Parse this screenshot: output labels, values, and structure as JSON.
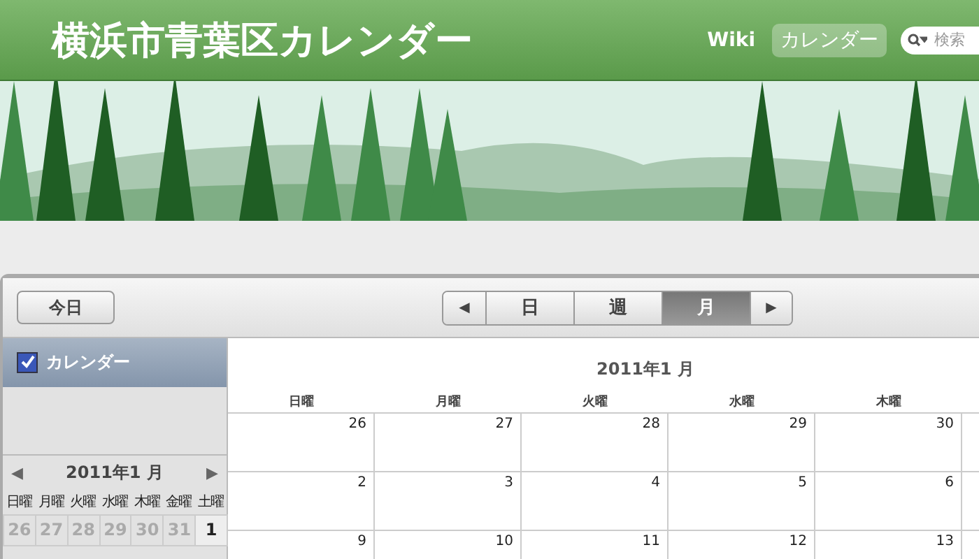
{
  "header": {
    "title": "横浜市青葉区カレンダー",
    "nav": [
      {
        "label": "Wiki",
        "selected": false
      },
      {
        "label": "カレンダー",
        "selected": true
      }
    ],
    "search": {
      "placeholder": "検索"
    }
  },
  "toolbar": {
    "today": "今日",
    "prev": "◀",
    "next": "▶",
    "views": [
      {
        "label": "日",
        "selected": false
      },
      {
        "label": "週",
        "selected": false
      },
      {
        "label": "月",
        "selected": true
      }
    ]
  },
  "sidebar": {
    "calendars": [
      {
        "label": "カレンダー",
        "checked": true
      }
    ],
    "mini_calendar": {
      "prev": "◀",
      "title": "2011年1 月",
      "next": "▶",
      "weekdays": [
        "日曜",
        "月曜",
        "火曜",
        "水曜",
        "木曜",
        "金曜",
        "土曜"
      ],
      "weeks": [
        [
          {
            "day": "26",
            "other_month": true
          },
          {
            "day": "27",
            "other_month": true
          },
          {
            "day": "28",
            "other_month": true
          },
          {
            "day": "29",
            "other_month": true
          },
          {
            "day": "30",
            "other_month": true
          },
          {
            "day": "31",
            "other_month": true
          },
          {
            "day": "1",
            "other_month": false
          }
        ]
      ]
    }
  },
  "month_view": {
    "title": "2011年1 月",
    "weekdays": [
      "日曜",
      "月曜",
      "火曜",
      "水曜",
      "木曜"
    ],
    "weeks": [
      [
        "26",
        "27",
        "28",
        "29",
        "30"
      ],
      [
        "2",
        "3",
        "4",
        "5",
        "6"
      ],
      [
        "9",
        "10",
        "11",
        "12",
        "13"
      ]
    ]
  }
}
